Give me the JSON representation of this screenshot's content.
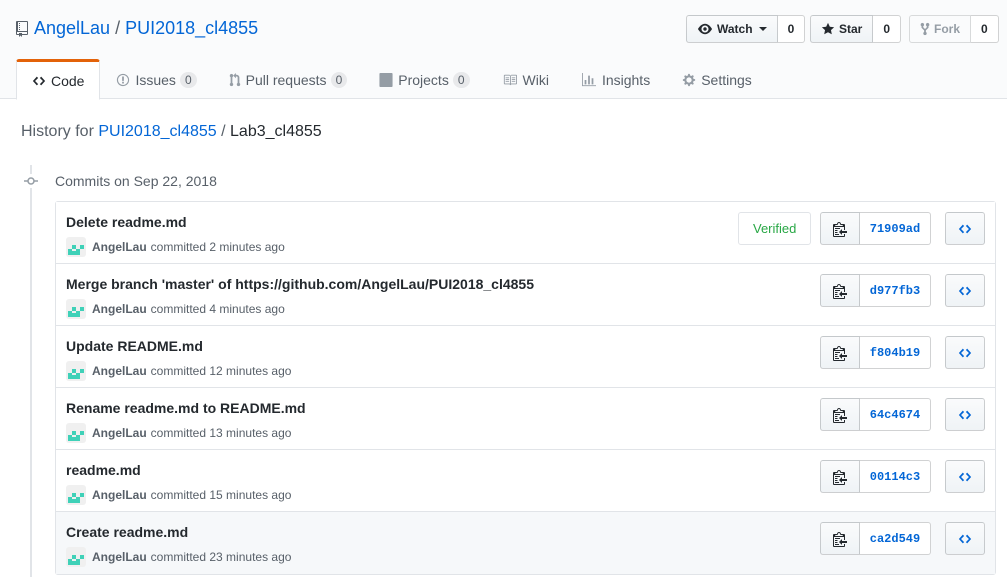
{
  "repo": {
    "owner": "AngelLau",
    "separator": "/",
    "name": "PUI2018_cl4855"
  },
  "actions": {
    "watch_label": "Watch",
    "watch_count": "0",
    "star_label": "Star",
    "star_count": "0",
    "fork_label": "Fork",
    "fork_count": "0"
  },
  "tabs": [
    {
      "label": "Code",
      "icon": "code-icon"
    },
    {
      "label": "Issues",
      "count": "0",
      "icon": "issue-icon"
    },
    {
      "label": "Pull requests",
      "count": "0",
      "icon": "pull-request-icon"
    },
    {
      "label": "Projects",
      "count": "0",
      "icon": "project-icon"
    },
    {
      "label": "Wiki",
      "icon": "book-icon"
    },
    {
      "label": "Insights",
      "icon": "graph-icon"
    },
    {
      "label": "Settings",
      "icon": "gear-icon"
    }
  ],
  "history": {
    "prefix": "History for",
    "repo_link": "PUI2018_cl4855",
    "separator": "/",
    "path": "Lab3_cl4855"
  },
  "commits_title": "Commits on Sep 22, 2018",
  "commits": [
    {
      "message": "Delete readme.md",
      "author": "AngelLau",
      "action": "committed",
      "time": "2 minutes ago",
      "verified": "Verified",
      "sha": "71909ad"
    },
    {
      "message": "Merge branch 'master' of https://github.com/AngelLau/PUI2018_cl4855",
      "author": "AngelLau",
      "action": "committed",
      "time": "4 minutes ago",
      "sha": "d977fb3"
    },
    {
      "message": "Update README.md",
      "author": "AngelLau",
      "action": "committed",
      "time": "12 minutes ago",
      "sha": "f804b19"
    },
    {
      "message": "Rename readme.md to README.md",
      "author": "AngelLau",
      "action": "committed",
      "time": "13 minutes ago",
      "sha": "64c4674"
    },
    {
      "message": "readme.md",
      "author": "AngelLau",
      "action": "committed",
      "time": "15 minutes ago",
      "sha": "00114c3"
    },
    {
      "message": "Create readme.md",
      "author": "AngelLau",
      "action": "committed",
      "time": "23 minutes ago",
      "sha": "ca2d549"
    }
  ],
  "colors": {
    "link": "#0366d6",
    "tab_accent": "#e36209",
    "verified": "#28a745",
    "avatar": "#3fd1b8"
  }
}
